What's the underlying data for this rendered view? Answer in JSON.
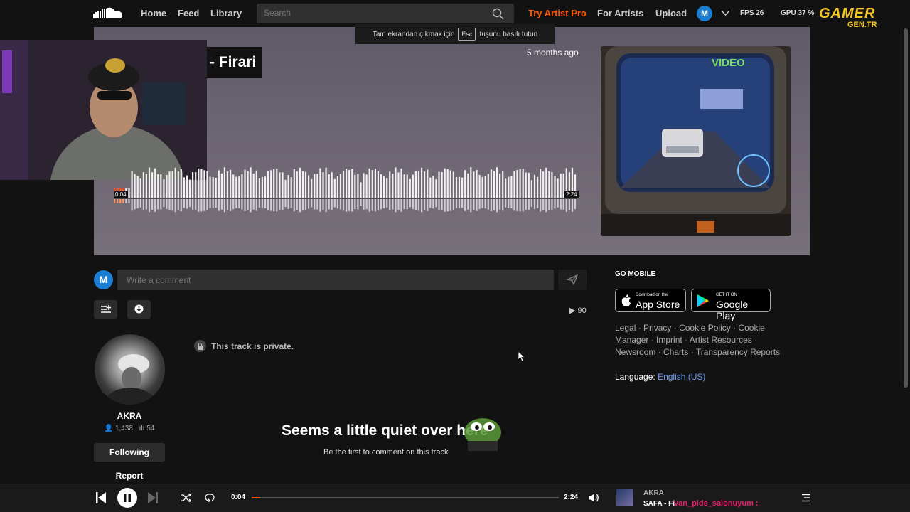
{
  "nav": {
    "home": "Home",
    "feed": "Feed",
    "library": "Library",
    "search_placeholder": "Search",
    "try_pro": "Try Artist Pro",
    "for_artists": "For Artists",
    "upload": "Upload",
    "avatar_initial": "M",
    "accent": "#ff5500"
  },
  "overlay": {
    "fps": "FPS 26",
    "gpu": "GPU 37 %",
    "gamer_logo": "GAMER",
    "gamer_sub": "GEN.TR"
  },
  "fullscreen_notice": {
    "before": "Tam ekrandan çıkmak için",
    "key": "Esc",
    "after": "tuşunu basılı tutun"
  },
  "hero": {
    "title_fragment": "- Firari",
    "posted": "5 months ago",
    "elapsed": "0:04",
    "duration": "2:24",
    "progress": 0.028
  },
  "comments": {
    "avatar_initial": "M",
    "placeholder": "Write a comment",
    "plays": "90",
    "private_note": "This track is private.",
    "empty_title": "Seems a little quiet over here",
    "empty_sub": "Be the first to comment on this track"
  },
  "artist": {
    "name": "AKRA",
    "followers": "1,438",
    "tracks": "54",
    "follow_label": "Following",
    "report_label": "Report"
  },
  "sidebar": {
    "go_mobile": "GO MOBILE",
    "app_store_small": "Download on the",
    "app_store_big": "App Store",
    "google_small": "GET IT ON",
    "google_big": "Google Play",
    "links": [
      "Legal",
      "Privacy",
      "Cookie Policy",
      "Cookie Manager",
      "Imprint",
      "Artist Resources",
      "Newsroom",
      "Charts",
      "Transparency Reports"
    ],
    "language_label": "Language:",
    "language_value": "English (US)"
  },
  "player": {
    "current": "0:04",
    "duration": "2:24",
    "artist": "AKRA",
    "title": "SAFA - Fi",
    "chat_overlay": "van_pide_salonuyum :"
  }
}
